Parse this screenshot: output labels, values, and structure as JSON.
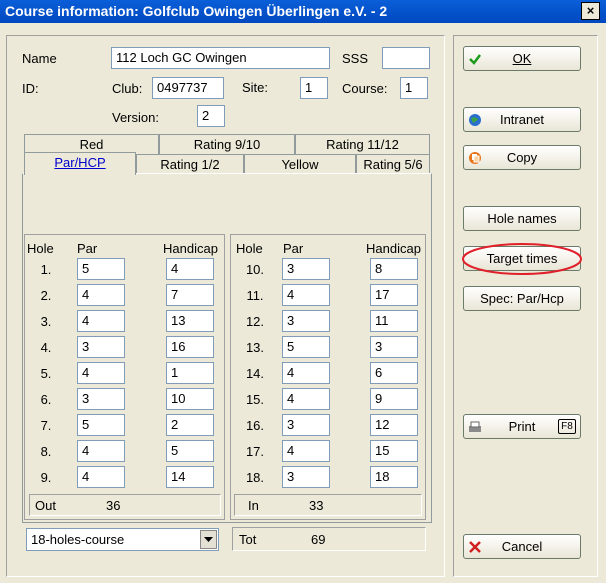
{
  "window": {
    "title": "Course information: Golfclub Owingen Überlingen e.V. - 2",
    "close_glyph": "×"
  },
  "form": {
    "name_label": "Name",
    "name_value": "112 Loch GC Owingen",
    "sss_label": "SSS",
    "sss_value": "",
    "id_label": "ID:",
    "club_label": "Club:",
    "club_value": "0497737",
    "site_label": "Site:",
    "site_value": "1",
    "course_label": "Course:",
    "course_value": "1",
    "version_label": "Version:",
    "version_value": "2"
  },
  "tabs": {
    "row1": [
      "Red",
      "Rating 9/10",
      "Rating 11/12"
    ],
    "row2": [
      "Par/HCP",
      "Rating 1/2",
      "Yellow",
      "Rating 5/6"
    ],
    "active": "Par/HCP"
  },
  "table": {
    "col_hole": "Hole",
    "col_par": "Par",
    "col_hcp": "Handicap",
    "front": [
      {
        "hole": "1.",
        "par": "5",
        "hcp": "4"
      },
      {
        "hole": "2.",
        "par": "4",
        "hcp": "7"
      },
      {
        "hole": "3.",
        "par": "4",
        "hcp": "13"
      },
      {
        "hole": "4.",
        "par": "3",
        "hcp": "16"
      },
      {
        "hole": "5.",
        "par": "4",
        "hcp": "1"
      },
      {
        "hole": "6.",
        "par": "3",
        "hcp": "10"
      },
      {
        "hole": "7.",
        "par": "5",
        "hcp": "2"
      },
      {
        "hole": "8.",
        "par": "4",
        "hcp": "5"
      },
      {
        "hole": "9.",
        "par": "4",
        "hcp": "14"
      }
    ],
    "back": [
      {
        "hole": "10.",
        "par": "3",
        "hcp": "8"
      },
      {
        "hole": "11.",
        "par": "4",
        "hcp": "17"
      },
      {
        "hole": "12.",
        "par": "3",
        "hcp": "11"
      },
      {
        "hole": "13.",
        "par": "5",
        "hcp": "3"
      },
      {
        "hole": "14.",
        "par": "4",
        "hcp": "6"
      },
      {
        "hole": "15.",
        "par": "4",
        "hcp": "9"
      },
      {
        "hole": "16.",
        "par": "3",
        "hcp": "12"
      },
      {
        "hole": "17.",
        "par": "4",
        "hcp": "15"
      },
      {
        "hole": "18.",
        "par": "3",
        "hcp": "18"
      }
    ],
    "out_label": "Out",
    "out_value": "36",
    "in_label": "In",
    "in_value": "33",
    "tot_label": "Tot",
    "tot_value": "69"
  },
  "course_type": {
    "selected": "18-holes-course"
  },
  "buttons": {
    "ok": "OK",
    "intranet": "Intranet",
    "copy": "Copy",
    "hole_names": "Hole names",
    "target_times": "Target times",
    "spec": "Spec: Par/Hcp",
    "print": "Print",
    "print_key": "F8",
    "cancel": "Cancel"
  },
  "colors": {
    "title_bar": "#0a5fd8",
    "highlight_ring": "#e0202a",
    "active_tab_text": "#0000cc"
  }
}
